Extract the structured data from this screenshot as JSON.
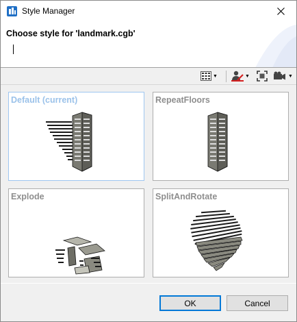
{
  "window": {
    "title": "Style Manager",
    "colors": {
      "accent": "#0078d7",
      "selected_label": "#9bc2ea",
      "label": "#8e8e8e"
    }
  },
  "header": {
    "heading": "Choose style for 'landmark.cgb'"
  },
  "toolbar": {
    "icons": [
      "grid-view-icon",
      "user-style-icon",
      "fit-view-icon",
      "camera-icon"
    ]
  },
  "styles": [
    {
      "label": "Default (current)",
      "selected": true
    },
    {
      "label": "RepeatFloors",
      "selected": false
    },
    {
      "label": "Explode",
      "selected": false
    },
    {
      "label": "SplitAndRotate",
      "selected": false
    }
  ],
  "buttons": {
    "ok": "OK",
    "cancel": "Cancel"
  }
}
